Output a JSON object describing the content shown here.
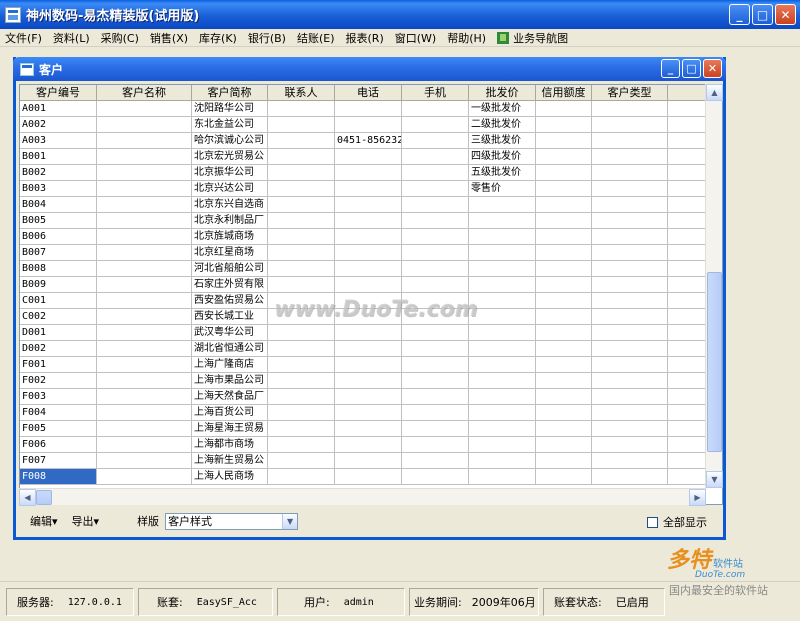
{
  "app": {
    "title": "神州数码-易杰精装版(试用版)",
    "window_buttons": {
      "minimize": "_",
      "maximize": "□",
      "close": "✕"
    }
  },
  "menu": [
    "文件(F)",
    "资料(L)",
    "采购(C)",
    "销售(X)",
    "库存(K)",
    "银行(B)",
    "结账(E)",
    "报表(R)",
    "窗口(W)",
    "帮助(H)"
  ],
  "menu_nav": {
    "label": "业务导航图",
    "icon": "nav-map-icon"
  },
  "child": {
    "title": "客户",
    "columns": [
      "客户编号",
      "客户名称",
      "客户简称",
      "联系人",
      "电话",
      "手机",
      "批发价",
      "信用额度",
      "客户类型",
      ""
    ],
    "rows": [
      [
        "A001",
        "",
        "沈阳路华公司",
        "",
        "",
        "",
        "一级批发价",
        "",
        "",
        ""
      ],
      [
        "A002",
        "",
        "东北金益公司",
        "",
        "",
        "",
        "二级批发价",
        "",
        "",
        ""
      ],
      [
        "A003",
        "",
        "哈尔滨诚心公司",
        "",
        "0451-856232",
        "",
        "三级批发价",
        "",
        "",
        ""
      ],
      [
        "B001",
        "",
        "北京宏光贸易公",
        "",
        "",
        "",
        "四级批发价",
        "",
        "",
        ""
      ],
      [
        "B002",
        "",
        "北京振华公司",
        "",
        "",
        "",
        "五级批发价",
        "",
        "",
        ""
      ],
      [
        "B003",
        "",
        "北京兴达公司",
        "",
        "",
        "",
        "零售价",
        "",
        "",
        ""
      ],
      [
        "B004",
        "",
        "北京东兴自选商",
        "",
        "",
        "",
        "",
        "",
        "",
        ""
      ],
      [
        "B005",
        "",
        "北京永利制品厂",
        "",
        "",
        "",
        "",
        "",
        "",
        ""
      ],
      [
        "B006",
        "",
        "北京旌城商场",
        "",
        "",
        "",
        "",
        "",
        "",
        ""
      ],
      [
        "B007",
        "",
        "北京红星商场",
        "",
        "",
        "",
        "",
        "",
        "",
        ""
      ],
      [
        "B008",
        "",
        "河北省船舶公司",
        "",
        "",
        "",
        "",
        "",
        "",
        ""
      ],
      [
        "B009",
        "",
        "石家庄外贸有限",
        "",
        "",
        "",
        "",
        "",
        "",
        ""
      ],
      [
        "C001",
        "",
        "西安盈佑贸易公",
        "",
        "",
        "",
        "",
        "",
        "",
        ""
      ],
      [
        "C002",
        "",
        "西安长城工业",
        "",
        "",
        "",
        "",
        "",
        "",
        ""
      ],
      [
        "D001",
        "",
        "武汉粤华公司",
        "",
        "",
        "",
        "",
        "",
        "",
        ""
      ],
      [
        "D002",
        "",
        "湖北省恒通公司",
        "",
        "",
        "",
        "",
        "",
        "",
        ""
      ],
      [
        "F001",
        "",
        "上海广隆商店",
        "",
        "",
        "",
        "",
        "",
        "",
        ""
      ],
      [
        "F002",
        "",
        "上海市果品公司",
        "",
        "",
        "",
        "",
        "",
        "",
        ""
      ],
      [
        "F003",
        "",
        "上海天然食品厂",
        "",
        "",
        "",
        "",
        "",
        "",
        ""
      ],
      [
        "F004",
        "",
        "上海百货公司",
        "",
        "",
        "",
        "",
        "",
        "",
        ""
      ],
      [
        "F005",
        "",
        "上海星海王贸易",
        "",
        "",
        "",
        "",
        "",
        "",
        ""
      ],
      [
        "F006",
        "",
        "上海都市商场",
        "",
        "",
        "",
        "",
        "",
        "",
        ""
      ],
      [
        "F007",
        "",
        "上海新生贸易公",
        "",
        "",
        "",
        "",
        "",
        "",
        ""
      ],
      [
        "F008",
        "",
        "上海人民商场",
        "",
        "",
        "",
        "",
        "",
        "",
        ""
      ]
    ],
    "selected_row": 23,
    "toolbar": {
      "edit": "编辑",
      "export": "导出",
      "template_label": "样版",
      "template_value": "客户样式",
      "show_all": "全部显示"
    }
  },
  "status": {
    "server_label": "服务器:",
    "server_value": "127.0.0.1",
    "account_label": "账套:",
    "account_value": "EasySF_Acc",
    "user_label": "用户:",
    "user_value": "admin",
    "period_label": "业务期间:",
    "period_value": "2009年06月",
    "state_label": "账套状态:",
    "state_value": "已启用"
  },
  "watermarks": {
    "center": "www.DuoTe.com",
    "logo_big": "多特",
    "logo_small": "软件站",
    "logo_site": "DuoTe.com",
    "logo_sub": "国内最安全的软件站"
  },
  "colors": {
    "title_blue": "#0a5ee0",
    "select_blue": "#316ac5",
    "window_bg": "#ece9d8"
  }
}
